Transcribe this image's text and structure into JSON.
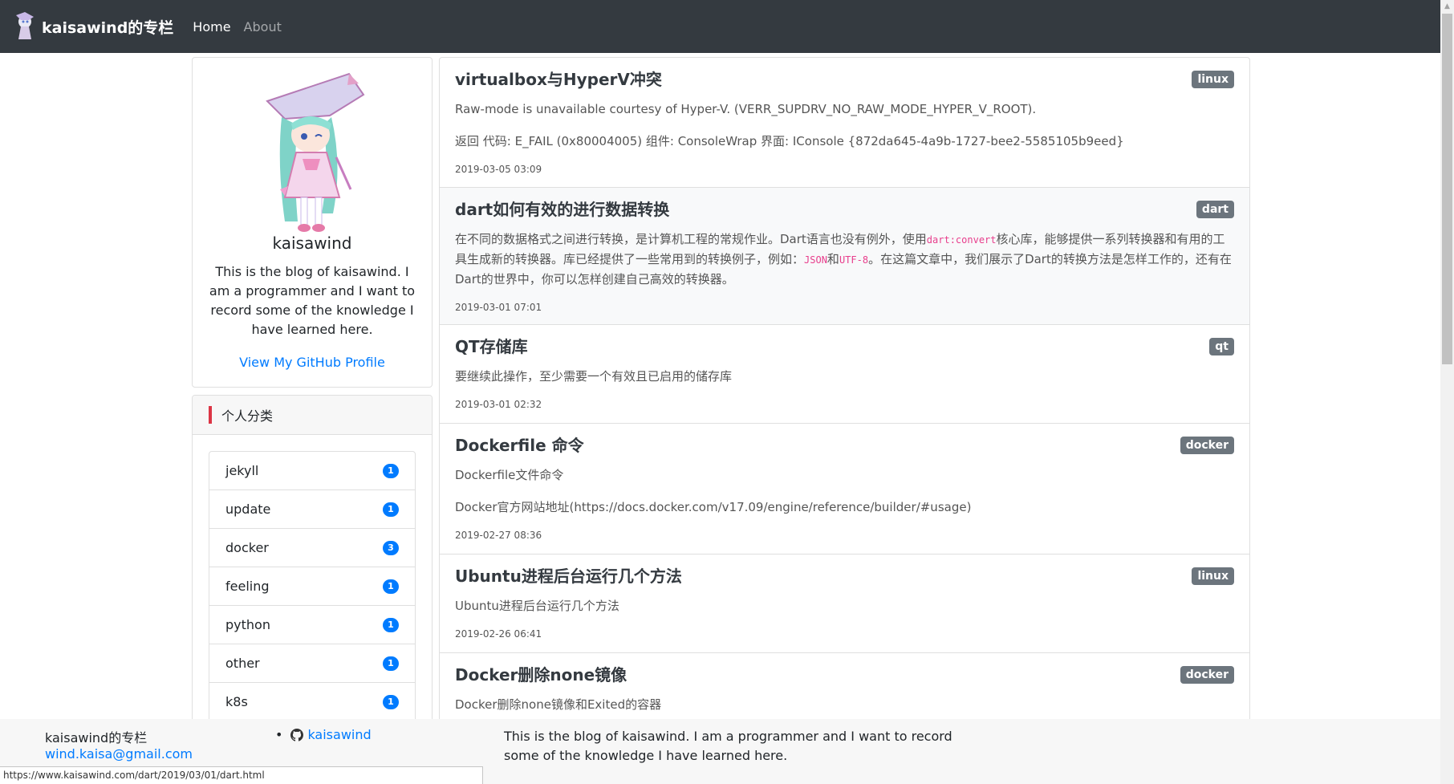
{
  "navbar": {
    "brand": "kaisawind的专栏",
    "links": [
      "Home",
      "About"
    ]
  },
  "profile": {
    "name": "kaisawind",
    "bio": "This is the blog of kaisawind. I am a programmer and I want to record some of the knowledge I have learned here.",
    "github_link": "View My GitHub Profile"
  },
  "categories": {
    "title": "个人分类",
    "items": [
      {
        "name": "jekyll",
        "count": "1"
      },
      {
        "name": "update",
        "count": "1"
      },
      {
        "name": "docker",
        "count": "3"
      },
      {
        "name": "feeling",
        "count": "1"
      },
      {
        "name": "python",
        "count": "1"
      },
      {
        "name": "other",
        "count": "1"
      },
      {
        "name": "k8s",
        "count": "1"
      }
    ]
  },
  "posts": [
    {
      "title": "virtualbox与HyperV冲突",
      "tag": "linux",
      "paragraphs": [
        "Raw-mode is unavailable courtesy of Hyper-V. (VERR_SUPDRV_NO_RAW_MODE_HYPER_V_ROOT).",
        "返回 代码: E_FAIL (0x80004005) 组件: ConsoleWrap 界面: IConsole {872da645-4a9b-1727-bee2-5585105b9eed}"
      ],
      "date": "2019-03-05 03:09"
    },
    {
      "title": "dart如何有效的进行数据转换",
      "tag": "dart",
      "rich": {
        "t1": "在不同的数据格式之间进行转换，是计算机工程的常规作业。Dart语言也没有例外，使用",
        "c1": "dart:convert",
        "t2": "核心库，能够提供一系列转换器和有用的工具生成新的转换器。库已经提供了一些常用到的转换例子，例如：",
        "c2": "JSON",
        "t3": "和",
        "c3": "UTF-8",
        "t4": "。在这篇文章中，我们展示了Dart的转换方法是怎样工作的，还有在Dart的世界中，你可以怎样创建自己高效的转换器。"
      },
      "date": "2019-03-01 07:01"
    },
    {
      "title": "QT存储库",
      "tag": "qt",
      "paragraphs": [
        "要继续此操作，至少需要一个有效且已启用的储存库"
      ],
      "date": "2019-03-01 02:32"
    },
    {
      "title": "Dockerfile 命令",
      "tag": "docker",
      "paragraphs": [
        "Dockerfile文件命令",
        "Docker官方网站地址(https://docs.docker.com/v17.09/engine/reference/builder/#usage)"
      ],
      "date": "2019-02-27 08:36"
    },
    {
      "title": "Ubuntu进程后台运行几个方法",
      "tag": "linux",
      "paragraphs": [
        "Ubuntu进程后台运行几个方法"
      ],
      "date": "2019-02-26 06:41"
    },
    {
      "title": "Docker删除none镜像",
      "tag": "docker",
      "paragraphs": [
        "Docker删除none镜像和Exited的容器"
      ],
      "date": ""
    }
  ],
  "footer": {
    "site_name": "kaisawind的专栏",
    "email": "wind.kaisa@gmail.com",
    "github_user": "kaisawind",
    "description": "This is the blog of kaisawind. I am a programmer and I want to record some of the knowledge I have learned here."
  },
  "status_url": "https://www.kaisawind.com/dart/2019/03/01/dart.html"
}
